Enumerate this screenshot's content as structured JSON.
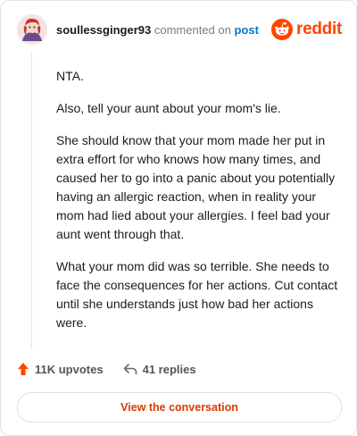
{
  "header": {
    "username": "soullessginger93",
    "action": "commented on",
    "post_link": "post",
    "brand": "reddit",
    "avatar_icon": "cartoon-avatar-icon",
    "brand_icon": "reddit-alien-icon",
    "brand_color": "#ff4500"
  },
  "comment": {
    "paragraphs": [
      "NTA.",
      "Also, tell your aunt about your mom's lie.",
      "She should know that your mom made her put in extra effort for who knows how many times, and caused her to go into a panic about you potentially having an allergic reaction, when in reality your mom had lied about your allergies. I feel bad your aunt went through that.",
      "What your mom did was so terrible. She needs to face the consequences for her actions. Cut contact until she understands just how bad her actions were."
    ]
  },
  "stats": {
    "upvotes": "11K upvotes",
    "replies": "41 replies",
    "upvote_icon": "upvote-arrow-icon",
    "reply_icon": "reply-arrow-icon",
    "upvote_color": "#ff4500"
  },
  "cta": {
    "label": "View the conversation"
  }
}
